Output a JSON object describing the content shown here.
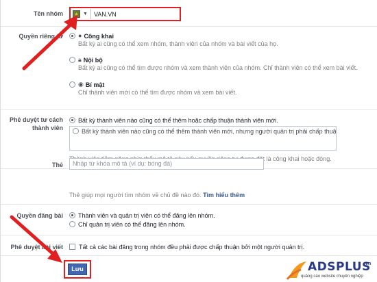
{
  "group_name": {
    "label": "Tên nhóm",
    "value": "VAN.VN",
    "icon": "flag-icon"
  },
  "privacy": {
    "label": "Quyền riêng tư",
    "options": [
      {
        "title": "Công khai",
        "desc": "Bất kỳ ai cũng có thể xem nhóm, thành viên của nhóm và bài viết của họ.",
        "icon": "globe-icon",
        "selected": true
      },
      {
        "title": "Nội bộ",
        "desc": "Bất kỳ ai cũng có thể tìm được nhóm và xem thành viên của nhóm. Chỉ thành viên có thể xem bài viết.",
        "icon": "lock-icon",
        "selected": false
      },
      {
        "title": "Bí mật",
        "desc": "Chỉ thành viên mới có thể tìm được nhóm và xem bài viết.",
        "icon": "secret-icon",
        "selected": false
      }
    ]
  },
  "membership": {
    "label": "Phê duyệt tư cách thành viên",
    "options": [
      {
        "text": "Bất kỳ thành viên nào cũng có thể thêm hoặc chấp thuận thành viên mới.",
        "selected": true
      },
      {
        "text": "Bất kỳ thành viên nào cũng có thể thêm thành viên mới, nhưng người quản trị phải chấp thuận những thành",
        "selected": false
      }
    ],
    "note": "Thành viên tiềm năng nhìn thấy mô tả này nếu quyền riêng tư được đặt là công khai hoặc đóng."
  },
  "tags": {
    "label": "Thẻ",
    "placeholder": "Nhập từ khóa mô tả (ví dụ: bóng đá)",
    "help": "Thẻ giúp mọi người tìm nhóm về chủ đề nào đó.",
    "link": "Tìm hiểu thêm"
  },
  "posting": {
    "label": "Quyền đăng bài",
    "options": [
      {
        "text": "Thành viên và quản trị viên có thể đăng lên nhóm.",
        "selected": true
      },
      {
        "text": "Chỉ quản trị viên có thể đăng lên nhóm.",
        "selected": false
      }
    ]
  },
  "post_approval": {
    "label": "Phê duyệt bài viết",
    "text": "Tất cả các bài đăng trong nhóm đều phải được chấp thuận bởi một người quản trị.",
    "checked": false
  },
  "actions": {
    "save": "Lưu"
  },
  "watermark": {
    "brand": "ADSPLUS",
    "suffix": ".vn",
    "tagline": "quảng cáo website chuyên nghiệp"
  },
  "colors": {
    "highlight": "#e02020",
    "button": "#4267b2",
    "brand": "#2a3a8a"
  }
}
